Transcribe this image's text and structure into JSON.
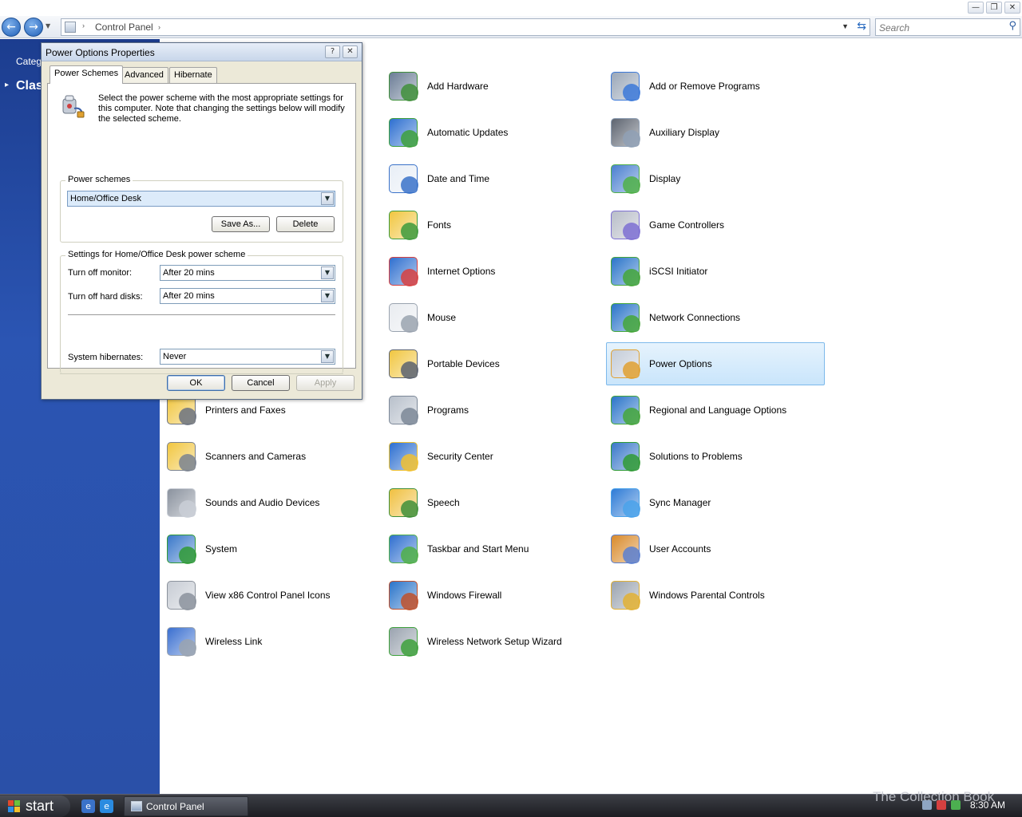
{
  "window": {
    "minimize_glyph": "—",
    "restore_glyph": "❐",
    "close_glyph": "✕"
  },
  "address_bar": {
    "breadcrumb": "Control Panel",
    "sep": "›",
    "search_placeholder": "Search",
    "back_glyph": "←",
    "forward_glyph": "→",
    "refresh_glyph": "⇆",
    "search_glyph": "⚲",
    "dropdown_glyph": "▼"
  },
  "left_pane": {
    "category_link": "Categ",
    "classic_view": "Clas",
    "arrow": "▸"
  },
  "items": [
    {
      "label": "Add Hardware",
      "icon": "add-hardware-icon",
      "c1": "#6b7d96",
      "c2": "#3f8f3a"
    },
    {
      "label": "Add or Remove Programs",
      "icon": "add-remove-programs-icon",
      "c1": "#9aa7b8",
      "c2": "#3b78d8"
    },
    {
      "label": "Automatic Updates",
      "icon": "automatic-updates-icon",
      "c1": "#2d6fd0",
      "c2": "#3da03b"
    },
    {
      "label": "Auxiliary Display",
      "icon": "auxiliary-display-icon",
      "c1": "#5d6470",
      "c2": "#8fa0b5"
    },
    {
      "label": "Date and Time",
      "icon": "date-time-icon",
      "c1": "#e8eef6",
      "c2": "#3a72c9"
    },
    {
      "label": "Display",
      "icon": "display-icon",
      "c1": "#4a7fd0",
      "c2": "#4fb048"
    },
    {
      "label": "Fonts",
      "icon": "fonts-icon",
      "c1": "#f1c640",
      "c2": "#3c9a3c"
    },
    {
      "label": "Game Controllers",
      "icon": "game-controllers-icon",
      "c1": "#b8bdc8",
      "c2": "#7d6fd2"
    },
    {
      "label": "Internet Options",
      "icon": "internet-options-icon",
      "c1": "#2f6fcf",
      "c2": "#d84040"
    },
    {
      "label": "iSCSI Initiator",
      "icon": "iscsi-initiator-icon",
      "c1": "#2a74c9",
      "c2": "#44a63a"
    },
    {
      "label": "Mouse",
      "icon": "mouse-icon",
      "c1": "#e9ecf0",
      "c2": "#9aa3af"
    },
    {
      "label": "Network Connections",
      "icon": "network-connections-icon",
      "c1": "#2a74c9",
      "c2": "#44a63a"
    },
    {
      "label": "Portable Devices",
      "icon": "portable-devices-icon",
      "c1": "#f1c640",
      "c2": "#5a6170"
    },
    {
      "label": "Power Options",
      "icon": "power-options-icon",
      "c1": "#c4ccd8",
      "c2": "#e0a030"
    },
    {
      "label": "Printers and Faxes",
      "icon": "printers-faxes-icon",
      "c1": "#f1c640",
      "c2": "#6b7280"
    },
    {
      "label": "Programs",
      "icon": "programs-icon",
      "c1": "#b8c0cb",
      "c2": "#7b8797"
    },
    {
      "label": "Regional and Language Options",
      "icon": "regional-language-icon",
      "c1": "#2a74c9",
      "c2": "#44a63a"
    },
    {
      "label": "Scanners and Cameras",
      "icon": "scanners-cameras-icon",
      "c1": "#f1c640",
      "c2": "#7a828f"
    },
    {
      "label": "Security Center",
      "icon": "security-center-icon",
      "c1": "#2d6fd0",
      "c2": "#f0c030"
    },
    {
      "label": "Solutions to Problems",
      "icon": "solutions-problems-icon",
      "c1": "#3a78c9",
      "c2": "#2f9a35"
    },
    {
      "label": "Sounds and Audio Devices",
      "icon": "sounds-audio-icon",
      "c1": "#8a929e",
      "c2": "#c9ced6"
    },
    {
      "label": "Speech",
      "icon": "speech-icon",
      "c1": "#f0c040",
      "c2": "#3f8f3a"
    },
    {
      "label": "Sync Manager",
      "icon": "sync-manager-icon",
      "c1": "#2e7bd6",
      "c2": "#4aa2ea"
    },
    {
      "label": "System",
      "icon": "system-icon",
      "c1": "#3a78c9",
      "c2": "#2f9a35"
    },
    {
      "label": "Taskbar and Start Menu",
      "icon": "taskbar-start-menu-icon",
      "c1": "#2f6fcf",
      "c2": "#4faf46"
    },
    {
      "label": "User Accounts",
      "icon": "user-accounts-icon",
      "c1": "#d98a2b",
      "c2": "#5a7fd0"
    },
    {
      "label": "View x86 Control Panel Icons",
      "icon": "x86-control-panel-icon",
      "c1": "#c7ccd4",
      "c2": "#8b929c"
    },
    {
      "label": "Windows Firewall",
      "icon": "windows-firewall-icon",
      "c1": "#2a74c9",
      "c2": "#c0502a"
    },
    {
      "label": "Windows Parental Controls",
      "icon": "parental-controls-icon",
      "c1": "#9aa3af",
      "c2": "#e2b032"
    },
    {
      "label": "Wireless Link",
      "icon": "wireless-link-icon",
      "c1": "#3a6fd0",
      "c2": "#9aa3af"
    },
    {
      "label": "Wireless Network Setup Wizard",
      "icon": "wireless-network-wizard-icon",
      "c1": "#9aa3af",
      "c2": "#3da03b"
    }
  ],
  "dialog": {
    "title": "Power Options Properties",
    "help_glyph": "?",
    "close_glyph": "✕",
    "tabs": [
      "Power Schemes",
      "Advanced",
      "Hibernate"
    ],
    "intro": "Select the power scheme with the most appropriate settings for this computer. Note that changing the settings below will modify the selected scheme.",
    "schemes_legend": "Power schemes",
    "selected_scheme": "Home/Office Desk",
    "save_as": "Save As...",
    "delete": "Delete",
    "settings_legend": "Settings for Home/Office Desk power scheme",
    "monitor_label": "Turn off monitor:",
    "monitor_value": "After 20 mins",
    "disks_label": "Turn off hard disks:",
    "disks_value": "After 20 mins",
    "hibernate_label": "System hibernates:",
    "hibernate_value": "Never",
    "ok": "OK",
    "cancel": "Cancel",
    "apply": "Apply",
    "dropdown_glyph": "▼"
  },
  "taskbar": {
    "start": "start",
    "task_label": "Control Panel",
    "clock": "8:30 AM",
    "watermark": "The Collection Book"
  }
}
